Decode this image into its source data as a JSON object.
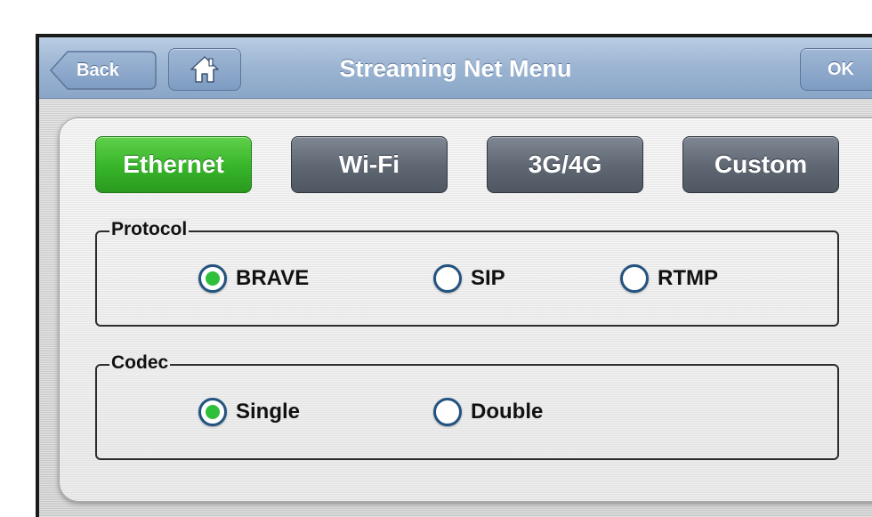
{
  "header": {
    "title": "Streaming Net Menu",
    "back_label": "Back",
    "ok_label": "OK",
    "home_icon": "home-icon"
  },
  "tabs": [
    {
      "label": "Ethernet",
      "active": true
    },
    {
      "label": "Wi-Fi",
      "active": false
    },
    {
      "label": "3G/4G",
      "active": false
    },
    {
      "label": "Custom",
      "active": false
    }
  ],
  "protocol": {
    "legend": "Protocol",
    "options": [
      {
        "label": "BRAVE",
        "selected": true
      },
      {
        "label": "SIP",
        "selected": false
      },
      {
        "label": "RTMP",
        "selected": false
      }
    ]
  },
  "codec": {
    "legend": "Codec",
    "options": [
      {
        "label": "Single",
        "selected": true
      },
      {
        "label": "Double",
        "selected": false
      }
    ]
  },
  "colors": {
    "active_tab": "#37b42a",
    "inactive_tab": "#5e6672",
    "titlebar": "#9bb4d2",
    "radio_fill": "#2fbf3a"
  }
}
